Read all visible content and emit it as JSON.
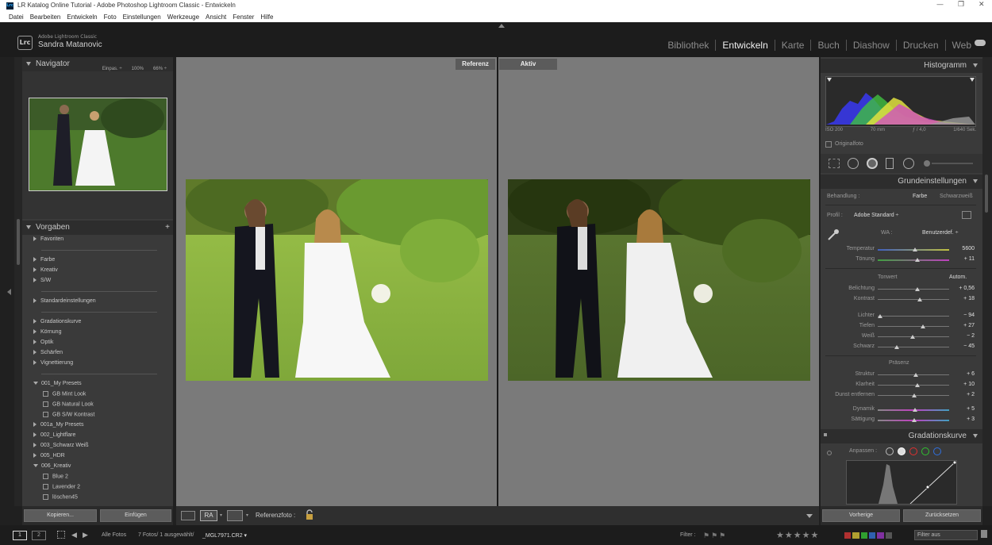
{
  "window": {
    "title": "LR Katalog Online Tutorial - Adobe Photoshop Lightroom Classic - Entwickeln",
    "app_icon_text": "Lrc"
  },
  "menu": [
    "Datei",
    "Bearbeiten",
    "Entwickeln",
    "Foto",
    "Einstellungen",
    "Werkzeuge",
    "Ansicht",
    "Fenster",
    "Hilfe"
  ],
  "brand": {
    "badge": "Lrc",
    "product": "Adobe Lightroom Classic",
    "user": "Sandra Matanovic"
  },
  "modules": [
    "Bibliothek",
    "Entwickeln",
    "Karte",
    "Buch",
    "Diashow",
    "Drucken",
    "Web"
  ],
  "active_module": "Entwickeln",
  "navigator": {
    "title": "Navigator",
    "fit": "Einpas. ÷",
    "zoom1": "100%",
    "zoom2": "66% ÷"
  },
  "presets": {
    "title": "Vorgaben",
    "add": "+",
    "groups": [
      "Favoriten",
      "Farbe",
      "Kreativ",
      "S/W",
      "Standardeinstellungen",
      "Gradationskurve",
      "Körnung",
      "Optik",
      "Schärfen",
      "Vignettierung",
      "001_My Presets",
      "001a_My Presets",
      "002_Lightflare",
      "003_Schwarz Weiß",
      "005_HDR",
      "006_Kreativ"
    ],
    "my_presets": [
      "GB Mint Look",
      "GB Natural Look",
      "GB S/W Kontrast"
    ],
    "kreativ": [
      "Blue 2",
      "Lavender 2",
      "löschen45"
    ]
  },
  "left_buttons": {
    "copy": "Kopieren...",
    "paste": "Einfügen"
  },
  "compare": {
    "reference": "Referenz",
    "active": "Aktiv"
  },
  "toolbar": {
    "view1": "RA",
    "reference_label": "Referenzfoto :"
  },
  "histogram": {
    "title": "Histogramm",
    "iso": "ISO 200",
    "focal": "70 mm",
    "aperture": "ƒ / 4,0",
    "shutter": "1/640 Sek.",
    "original": "Originalfoto"
  },
  "basic": {
    "title": "Grundeinstellungen",
    "treatment_label": "Behandlung :",
    "treatment_color": "Farbe",
    "treatment_bw": "Schwarzweiß",
    "profile_label": "Profil :",
    "profile_value": "Adobe Standard ÷",
    "wb_label": "WA :",
    "wb_value": "Benutzerdef. ÷",
    "tone_label": "Tonwert",
    "auto_label": "Autom.",
    "presence_label": "Präsenz",
    "sliders": [
      {
        "label": "Temperatur",
        "value": "5600",
        "pos": 0.52
      },
      {
        "label": "Tönung",
        "value": "+ 11",
        "pos": 0.55
      },
      {
        "label": "Belichtung",
        "value": "+ 0,56",
        "pos": 0.56
      },
      {
        "label": "Kontrast",
        "value": "+ 18",
        "pos": 0.59
      },
      {
        "label": "Lichter",
        "value": "− 94",
        "pos": 0.03
      },
      {
        "label": "Tiefen",
        "value": "+ 27",
        "pos": 0.63
      },
      {
        "label": "Weiß",
        "value": "− 2",
        "pos": 0.49
      },
      {
        "label": "Schwarz",
        "value": "− 45",
        "pos": 0.27
      },
      {
        "label": "Struktur",
        "value": "+ 6",
        "pos": 0.53
      },
      {
        "label": "Klarheit",
        "value": "+ 10",
        "pos": 0.55
      },
      {
        "label": "Dunst entfernen",
        "value": "+ 2",
        "pos": 0.51
      },
      {
        "label": "Dynamik",
        "value": "+ 5",
        "pos": 0.52
      },
      {
        "label": "Sättigung",
        "value": "+ 3",
        "pos": 0.51
      }
    ]
  },
  "curve": {
    "title": "Gradationskurve",
    "adjust_label": "Anpassen :"
  },
  "right_buttons": {
    "prev": "Vorherige",
    "reset": "Zurücksetzen"
  },
  "filmstrip": {
    "page1": "1",
    "page2": "2",
    "source": "Alle Fotos",
    "count": "7 Fotos/ 1 ausgewählt/",
    "file": "_MGL7971.CR2 ▾",
    "filter_label": "Filter :",
    "filter_off": "Filter aus"
  },
  "colors": {
    "accent_active": "#f0f0f0",
    "panel": "#3a3a3a",
    "canvas": "#7a7a7a"
  }
}
